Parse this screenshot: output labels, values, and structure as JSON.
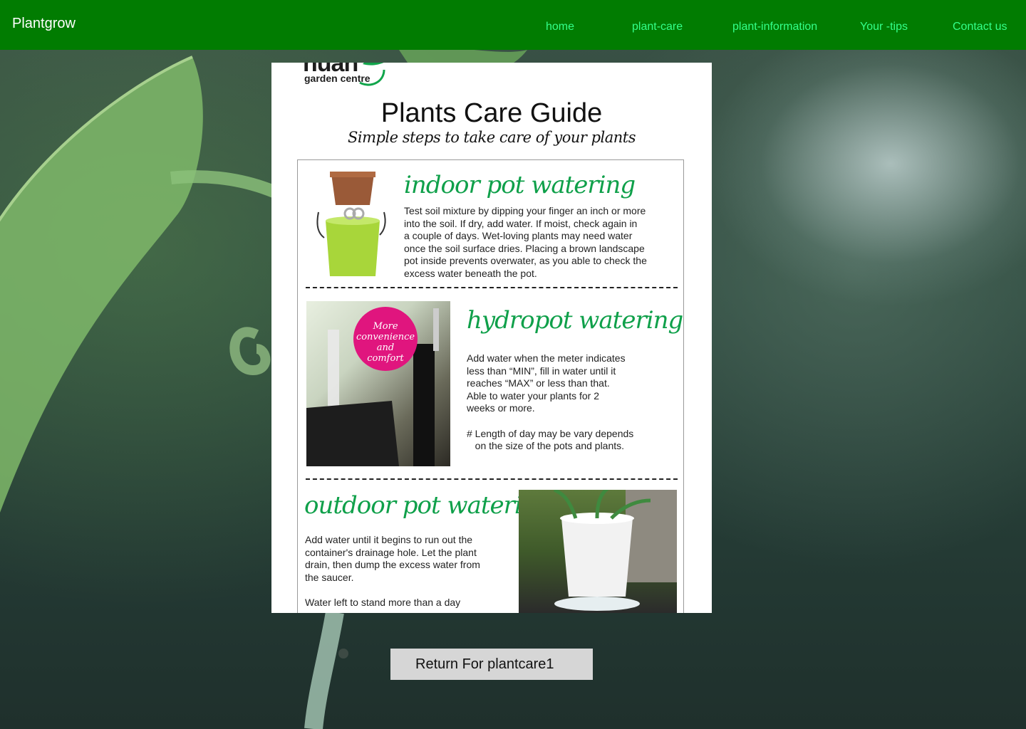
{
  "brand": "Plantgrow",
  "nav": {
    "home": "home",
    "plant_care": "plant-care",
    "plant_information": "plant-information",
    "your_tips": "Your -tips",
    "contact_us": "Contact us"
  },
  "guide": {
    "logo_word": "nuan",
    "logo_sub": "garden centre",
    "title": "Plants Care Guide",
    "subtitle": "Simple steps to take care of your plants",
    "sections": [
      {
        "title": "indoor pot watering",
        "lines": [
          "Test soil mixture by dipping your finger an inch or more",
          "into the soil. If dry, add water. If moist, check again in",
          "a couple of days. Wet-loving plants may need water",
          "once the soil surface dries. Placing a brown landscape",
          "pot inside prevents overwater, as you able to check the",
          "excess water beneath the pot."
        ]
      },
      {
        "title": "hydropot watering",
        "badge": [
          "More",
          "convenience",
          "and",
          "comfort"
        ],
        "lines": [
          "Add water when the meter indicates",
          "less than “MIN”, fill in water until it",
          "reaches “MAX” or less than that.",
          "Able to water your plants for 2",
          "weeks or more.",
          "",
          "# Length of day may be vary depends",
          "   on the size of the pots and plants."
        ]
      },
      {
        "title": "outdoor pot watering",
        "lines": [
          "Add water until it begins to run out the",
          "container's drainage hole. Let the plant",
          "drain, then dump the excess water from",
          "the saucer.",
          "",
          "Water left to stand more than a day"
        ]
      }
    ]
  },
  "return_button": "Return For plantcare1",
  "colors": {
    "nav_bg": "#017c01",
    "nav_link": "#33ff8a",
    "section_title": "#0fa04a",
    "badge": "#e0157e",
    "button_bg": "#d6d6d6"
  }
}
